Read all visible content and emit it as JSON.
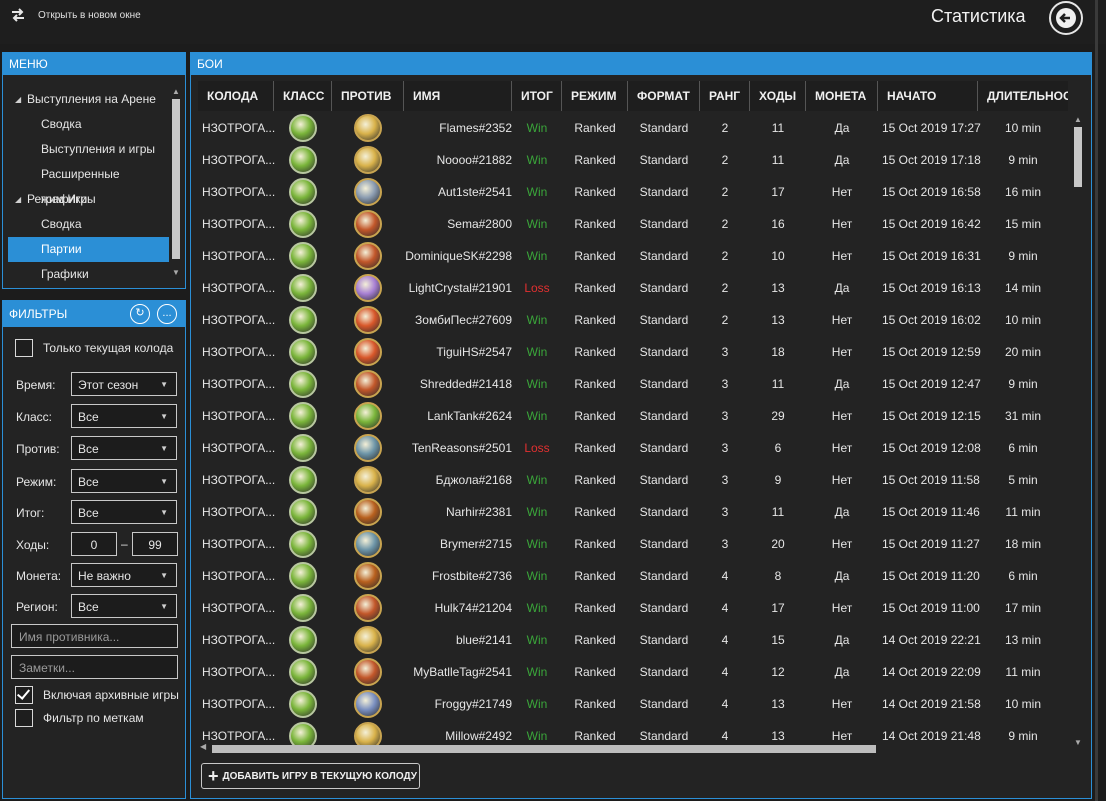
{
  "topbar": {
    "open_new_window": "Открыть в новом окне",
    "title": "Статистика"
  },
  "menu": {
    "title": "МЕНЮ",
    "items": [
      {
        "label": "Выступления на Арене",
        "type": "group"
      },
      {
        "label": "Сводка",
        "type": "child"
      },
      {
        "label": "Выступления и игры",
        "type": "child"
      },
      {
        "label": "Расширенные графики",
        "type": "child"
      },
      {
        "label": "Режим Игры",
        "type": "group"
      },
      {
        "label": "Сводка",
        "type": "child"
      },
      {
        "label": "Партии",
        "type": "child",
        "selected": true
      },
      {
        "label": "Графики",
        "type": "child"
      }
    ]
  },
  "filters": {
    "title": "ФИЛЬТРЫ",
    "refresh_icon": "refresh-icon",
    "more_label": "...",
    "current_deck_only": {
      "label": "Только текущая колода",
      "checked": false
    },
    "time": {
      "label": "Время:",
      "value": "Этот сезон"
    },
    "class": {
      "label": "Класс:",
      "value": "Все"
    },
    "opponent": {
      "label": "Против:",
      "value": "Все"
    },
    "mode": {
      "label": "Режим:",
      "value": "Все"
    },
    "result": {
      "label": "Итог:",
      "value": "Все"
    },
    "turns": {
      "label": "Ходы:",
      "from": "0",
      "dash": "–",
      "to": "99"
    },
    "coin": {
      "label": "Монета:",
      "value": "Не важно"
    },
    "region": {
      "label": "Регион:",
      "value": "Все"
    },
    "opponent_name_placeholder": "Имя противника...",
    "notes_placeholder": "Заметки...",
    "include_archived": {
      "label": "Включая архивные игры",
      "checked": true
    },
    "filter_by_tags": {
      "label": "Фильтр по меткам",
      "checked": false
    }
  },
  "games": {
    "title": "БОИ",
    "columns": [
      "КОЛОДА",
      "КЛАСС",
      "ПРОТИВ",
      "ИМЯ",
      "ИТОГ",
      "РЕЖИМ",
      "ФОРМАТ",
      "РАНГ",
      "ХОДЫ",
      "МОНЕТА",
      "НАЧАТО",
      "ДЛИТЕЛЬНОСТ"
    ],
    "class_colors": {
      "druid": "#7ab53a",
      "paladin": "#d9b24a",
      "warrior": "#8a9bb0",
      "warlock": "#c2572a",
      "priest": "#a77fd3",
      "mage": "#d8572a",
      "rogue": "#6d95a8",
      "hunter": "#b8601e",
      "shaman": "#7a8fc0"
    },
    "rows": [
      {
        "deck": "НЗОТРОГА...",
        "class": "druid",
        "opponent": "paladin",
        "name": "Flames#2352",
        "result": "Win",
        "mode": "Ranked",
        "format": "Standard",
        "rank": "2",
        "turns": "11",
        "coin": "Да",
        "started": "15 Oct 2019 17:27",
        "duration": "10 min"
      },
      {
        "deck": "НЗОТРОГА...",
        "class": "druid",
        "opponent": "paladin",
        "name": "Noooo#21882",
        "result": "Win",
        "mode": "Ranked",
        "format": "Standard",
        "rank": "2",
        "turns": "11",
        "coin": "Да",
        "started": "15 Oct 2019 17:18",
        "duration": "9 min"
      },
      {
        "deck": "НЗОТРОГА...",
        "class": "druid",
        "opponent": "warrior",
        "name": "Aut1ste#2541",
        "result": "Win",
        "mode": "Ranked",
        "format": "Standard",
        "rank": "2",
        "turns": "17",
        "coin": "Нет",
        "started": "15 Oct 2019 16:58",
        "duration": "16 min"
      },
      {
        "deck": "НЗОТРОГА...",
        "class": "druid",
        "opponent": "warlock",
        "name": "Sema#2800",
        "result": "Win",
        "mode": "Ranked",
        "format": "Standard",
        "rank": "2",
        "turns": "16",
        "coin": "Нет",
        "started": "15 Oct 2019 16:42",
        "duration": "15 min"
      },
      {
        "deck": "НЗОТРОГА...",
        "class": "druid",
        "opponent": "warlock",
        "name": "DominiqueSK#2298",
        "result": "Win",
        "mode": "Ranked",
        "format": "Standard",
        "rank": "2",
        "turns": "10",
        "coin": "Нет",
        "started": "15 Oct 2019 16:31",
        "duration": "9 min"
      },
      {
        "deck": "НЗОТРОГА...",
        "class": "druid",
        "opponent": "priest",
        "name": "LightCrystal#21901",
        "result": "Loss",
        "mode": "Ranked",
        "format": "Standard",
        "rank": "2",
        "turns": "13",
        "coin": "Да",
        "started": "15 Oct 2019 16:13",
        "duration": "14 min"
      },
      {
        "deck": "НЗОТРОГА...",
        "class": "druid",
        "opponent": "mage",
        "name": "ЗомбиПес#27609",
        "result": "Win",
        "mode": "Ranked",
        "format": "Standard",
        "rank": "2",
        "turns": "13",
        "coin": "Нет",
        "started": "15 Oct 2019 16:02",
        "duration": "10 min"
      },
      {
        "deck": "НЗОТРОГА...",
        "class": "druid",
        "opponent": "mage",
        "name": "TiguiHS#2547",
        "result": "Win",
        "mode": "Ranked",
        "format": "Standard",
        "rank": "3",
        "turns": "18",
        "coin": "Нет",
        "started": "15 Oct 2019 12:59",
        "duration": "20 min"
      },
      {
        "deck": "НЗОТРОГА...",
        "class": "druid",
        "opponent": "warlock",
        "name": "Shredded#21418",
        "result": "Win",
        "mode": "Ranked",
        "format": "Standard",
        "rank": "3",
        "turns": "11",
        "coin": "Да",
        "started": "15 Oct 2019 12:47",
        "duration": "9 min"
      },
      {
        "deck": "НЗОТРОГА...",
        "class": "druid",
        "opponent": "druid",
        "name": "LankTank#2624",
        "result": "Win",
        "mode": "Ranked",
        "format": "Standard",
        "rank": "3",
        "turns": "29",
        "coin": "Нет",
        "started": "15 Oct 2019 12:15",
        "duration": "31 min"
      },
      {
        "deck": "НЗОТРОГА...",
        "class": "druid",
        "opponent": "rogue",
        "name": "TenReasons#2501",
        "result": "Loss",
        "mode": "Ranked",
        "format": "Standard",
        "rank": "3",
        "turns": "6",
        "coin": "Нет",
        "started": "15 Oct 2019 12:08",
        "duration": "6 min"
      },
      {
        "deck": "НЗОТРОГА...",
        "class": "druid",
        "opponent": "paladin",
        "name": "Бджола#2168",
        "result": "Win",
        "mode": "Ranked",
        "format": "Standard",
        "rank": "3",
        "turns": "9",
        "coin": "Нет",
        "started": "15 Oct 2019 11:58",
        "duration": "5 min"
      },
      {
        "deck": "НЗОТРОГА...",
        "class": "druid",
        "opponent": "hunter",
        "name": "Narhir#2381",
        "result": "Win",
        "mode": "Ranked",
        "format": "Standard",
        "rank": "3",
        "turns": "11",
        "coin": "Да",
        "started": "15 Oct 2019 11:46",
        "duration": "11 min"
      },
      {
        "deck": "НЗОТРОГА...",
        "class": "druid",
        "opponent": "rogue",
        "name": "Brymer#2715",
        "result": "Win",
        "mode": "Ranked",
        "format": "Standard",
        "rank": "3",
        "turns": "20",
        "coin": "Нет",
        "started": "15 Oct 2019 11:27",
        "duration": "18 min"
      },
      {
        "deck": "НЗОТРОГА...",
        "class": "druid",
        "opponent": "hunter",
        "name": "Frostbite#2736",
        "result": "Win",
        "mode": "Ranked",
        "format": "Standard",
        "rank": "4",
        "turns": "8",
        "coin": "Да",
        "started": "15 Oct 2019 11:20",
        "duration": "6 min"
      },
      {
        "deck": "НЗОТРОГА...",
        "class": "druid",
        "opponent": "warlock",
        "name": "Hulk74#21204",
        "result": "Win",
        "mode": "Ranked",
        "format": "Standard",
        "rank": "4",
        "turns": "17",
        "coin": "Нет",
        "started": "15 Oct 2019 11:00",
        "duration": "17 min"
      },
      {
        "deck": "НЗОТРОГА...",
        "class": "druid",
        "opponent": "paladin",
        "name": "blue#2141",
        "result": "Win",
        "mode": "Ranked",
        "format": "Standard",
        "rank": "4",
        "turns": "15",
        "coin": "Да",
        "started": "14 Oct 2019 22:21",
        "duration": "13 min"
      },
      {
        "deck": "НЗОТРОГА...",
        "class": "druid",
        "opponent": "warlock",
        "name": "MyBatlleTag#2541",
        "result": "Win",
        "mode": "Ranked",
        "format": "Standard",
        "rank": "4",
        "turns": "12",
        "coin": "Да",
        "started": "14 Oct 2019 22:09",
        "duration": "11 min"
      },
      {
        "deck": "НЗОТРОГА...",
        "class": "druid",
        "opponent": "shaman",
        "name": "Froggy#21749",
        "result": "Win",
        "mode": "Ranked",
        "format": "Standard",
        "rank": "4",
        "turns": "13",
        "coin": "Нет",
        "started": "14 Oct 2019 21:58",
        "duration": "10 min"
      },
      {
        "deck": "НЗОТРОГА...",
        "class": "druid",
        "opponent": "paladin",
        "name": "Millow#2492",
        "result": "Win",
        "mode": "Ranked",
        "format": "Standard",
        "rank": "4",
        "turns": "13",
        "coin": "Нет",
        "started": "14 Oct 2019 21:48",
        "duration": "9 min"
      }
    ],
    "add_game_label": "ДОБАВИТЬ ИГРУ В ТЕКУЩУЮ КОЛОДУ"
  }
}
